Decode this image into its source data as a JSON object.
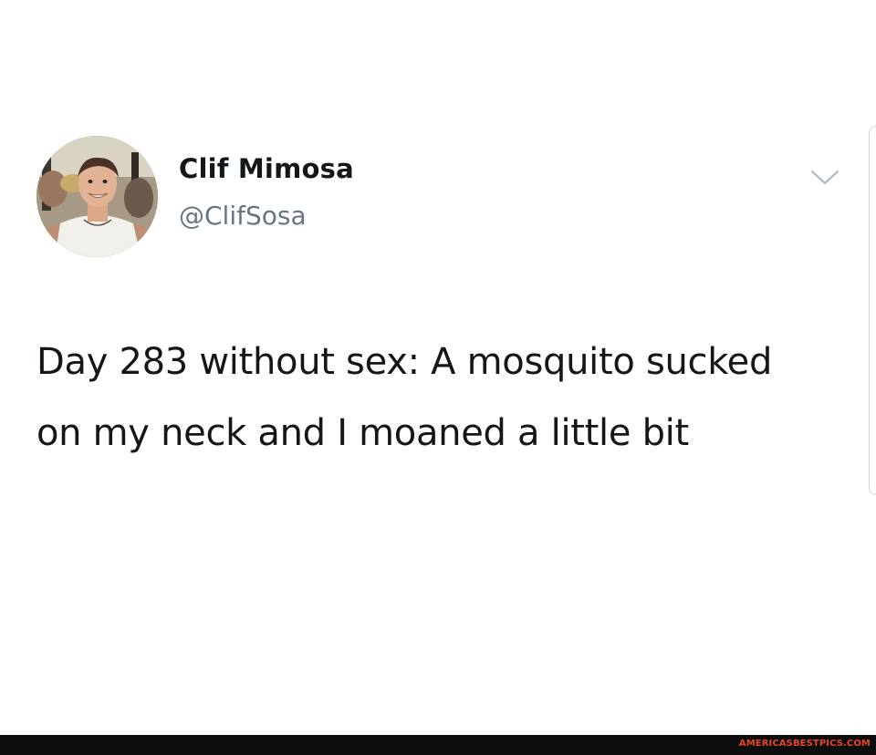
{
  "tweet": {
    "author": {
      "display_name": "Clif Mimosa",
      "handle": "@ClifSosa",
      "avatar_icon": "profile-photo"
    },
    "text": "Day 283 without sex: A mosquito sucked on my neck and I moaned a little bit",
    "menu_icon": "chevron-down-icon"
  },
  "footer": {
    "watermark": "AMERICASBESTPICS.COM"
  },
  "colors": {
    "background": "#ffffff",
    "primary_text": "#14171a",
    "secondary_text": "#657786",
    "chevron": "#aab8c2",
    "footer_bar": "#0d0d0d",
    "watermark": "#e8452c"
  }
}
